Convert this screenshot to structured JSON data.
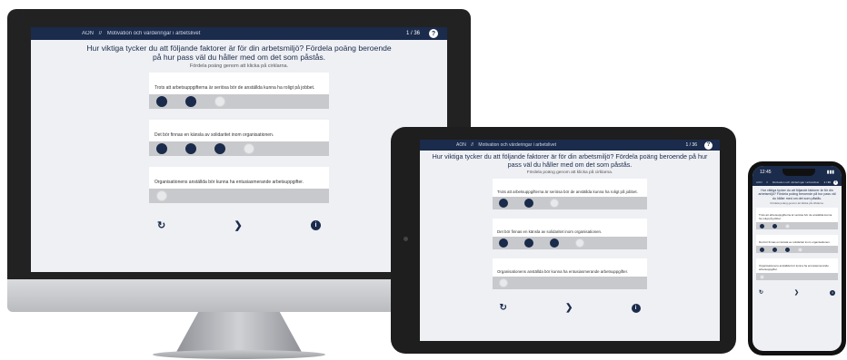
{
  "app": {
    "breadcrumb": [
      "AON",
      "//",
      "Motivation och värderingar i arbetslivet"
    ],
    "progress": "1 / 36",
    "help_icon": "?"
  },
  "phone_status": {
    "time": "12:45"
  },
  "question": {
    "text": "Hur viktiga tycker du att följande faktorer är för din arbetsmiljö? Fördela poäng beroende på hur pass väl du håller med om det som påstås.",
    "instruction": "Fördela poäng genom att klicka på cirklarna."
  },
  "statements": [
    {
      "text": "Trots att arbetsuppgifterna är seriösa bör de anställda kunna ha roligt på jobbet.",
      "filled": 2,
      "total": 3
    },
    {
      "text": "Det bör finnas en känsla av solidaritet inom organisationen.",
      "filled": 3,
      "total": 4
    },
    {
      "text": "Organisationens anställda bör kunna ha entusiasmerande arbetsuppgifter.",
      "filled": 0,
      "total": 1
    }
  ],
  "controls": {
    "reset_icon": "↻",
    "next_icon": "❯",
    "info_icon": "i"
  },
  "colors": {
    "brand_navy": "#1b2b4b",
    "background": "#eef0f4",
    "track": "#c8c9cc"
  }
}
